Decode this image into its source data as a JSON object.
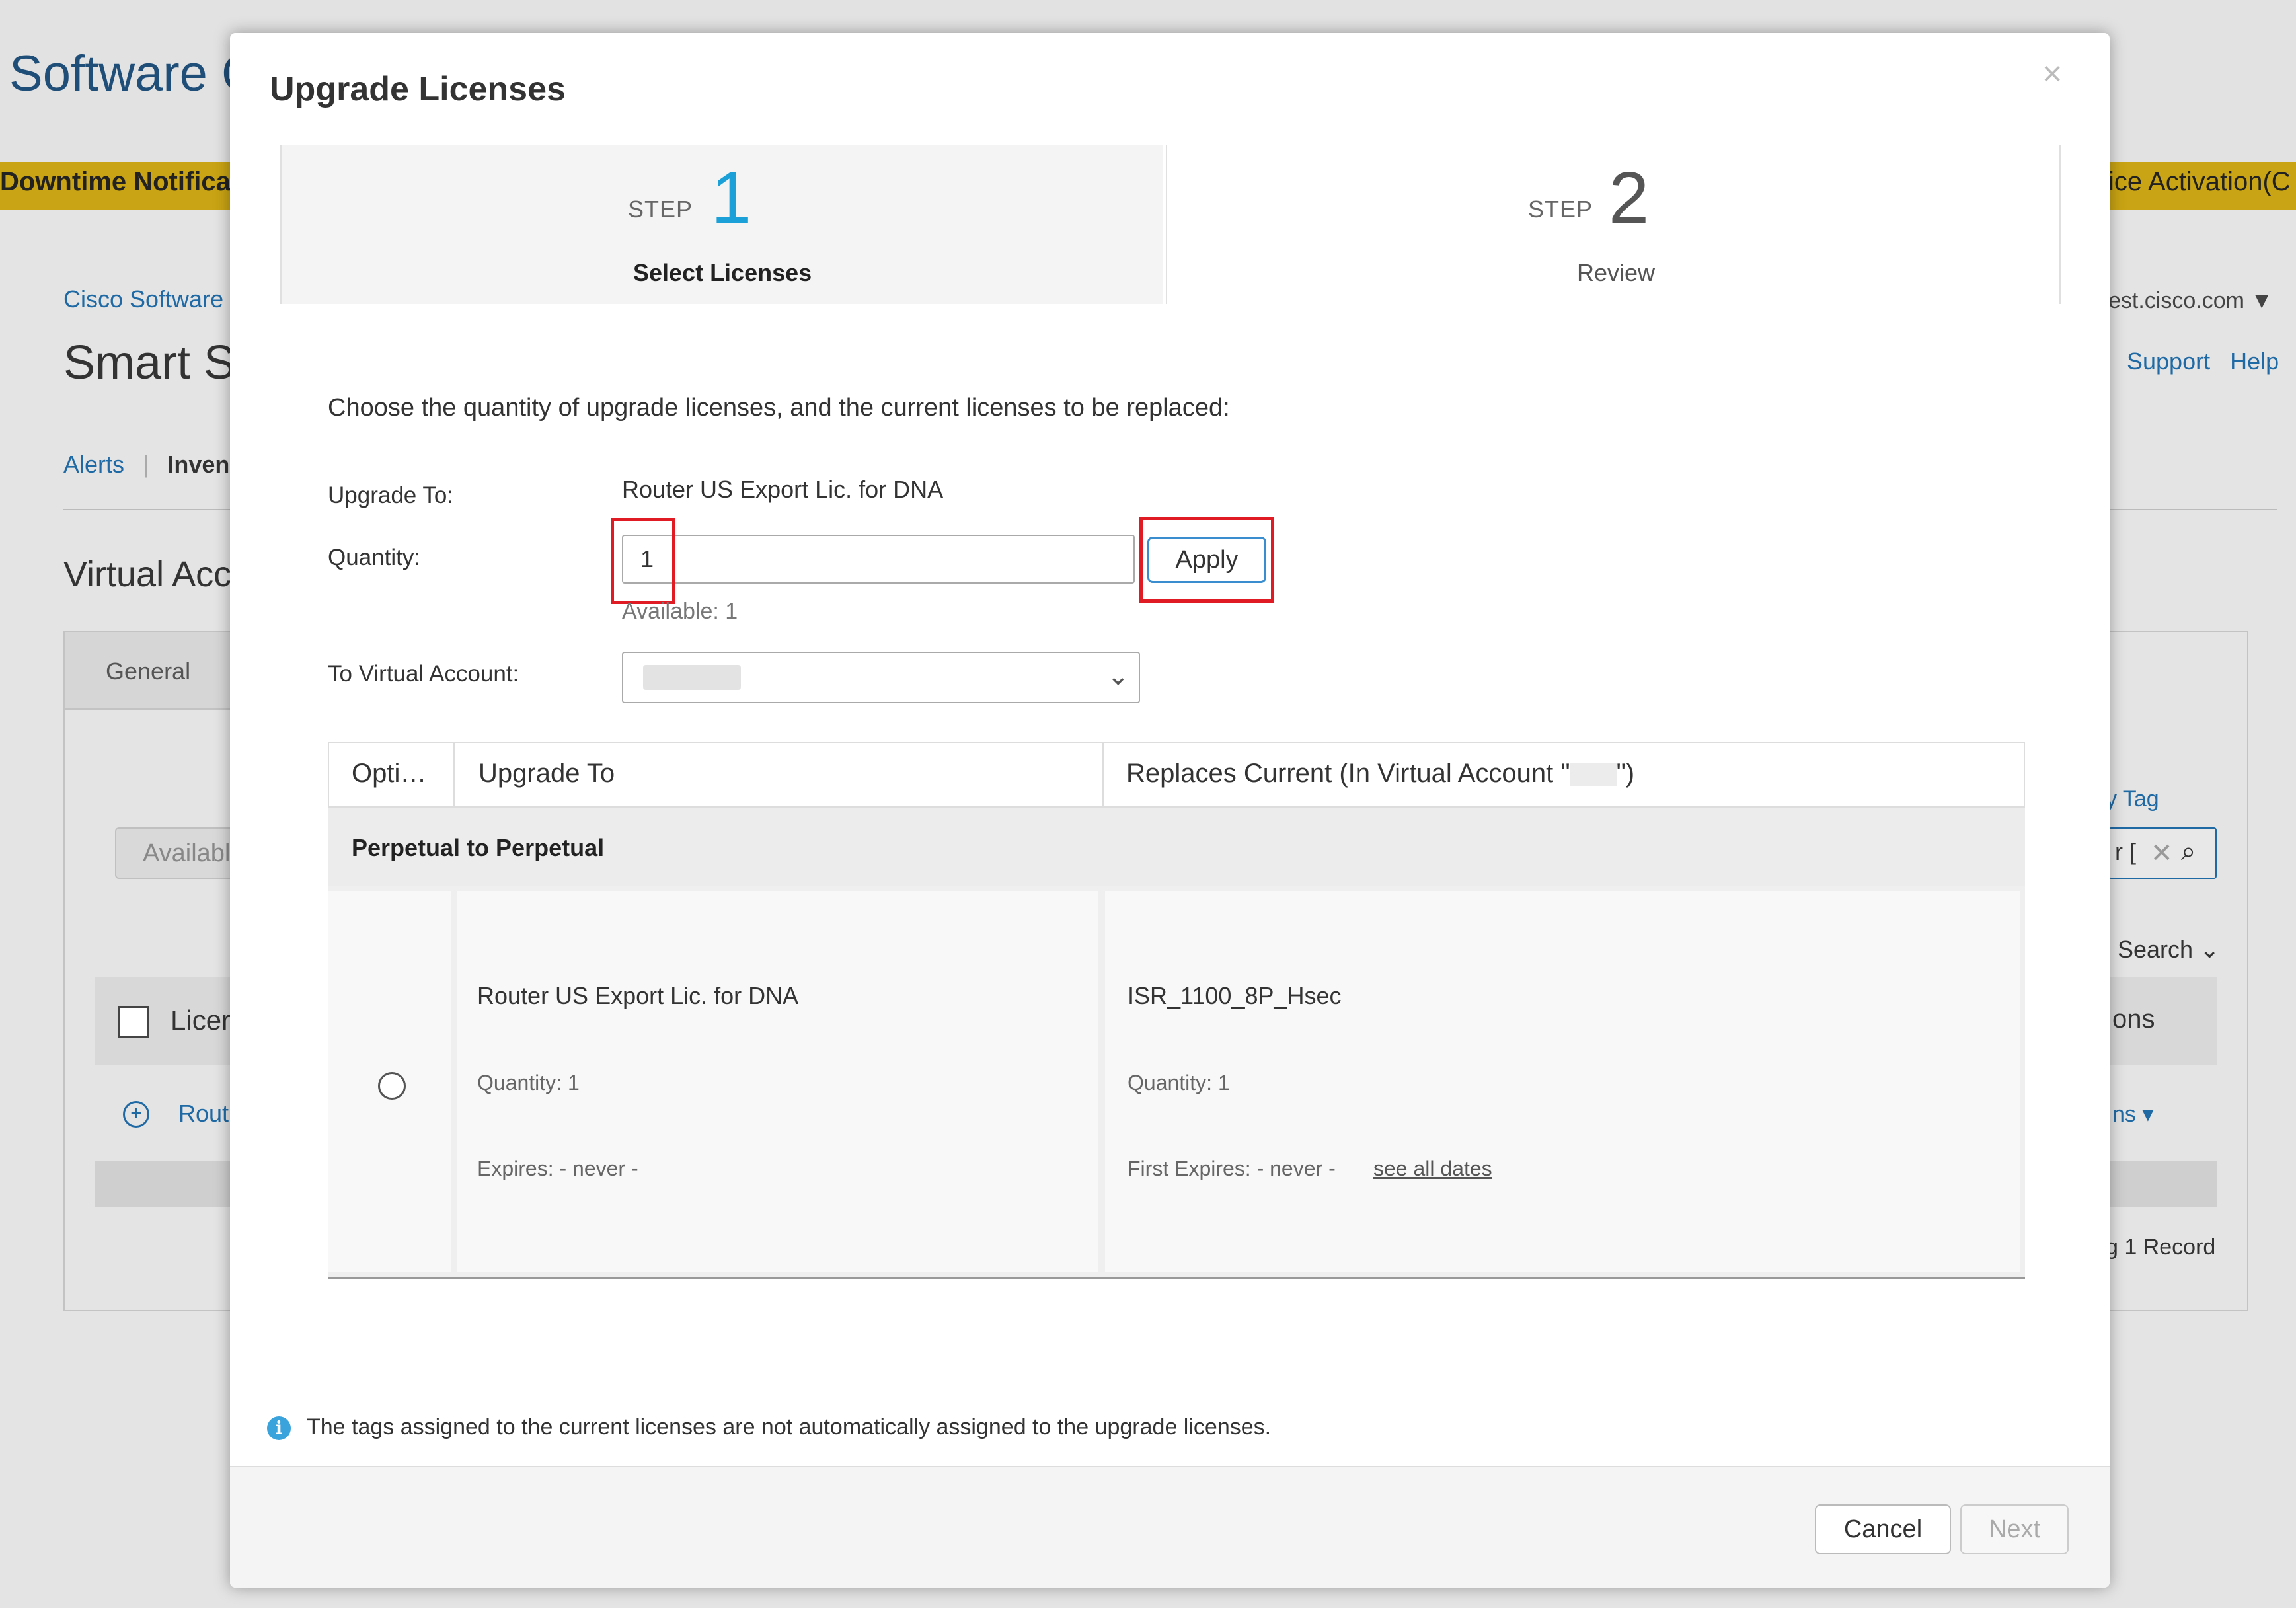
{
  "background": {
    "app_title": "Software C",
    "banner_left": "Downtime Notifica",
    "banner_right": "ice Activation(C",
    "breadcrumb": "Cisco Software C",
    "page_title": "Smart S",
    "nav_alerts": "Alerts",
    "nav_inventory": "Inven",
    "section_title": "Virtual Acc",
    "tab_general": "General",
    "available_button": "Availabl",
    "license_header": "Licer",
    "row_link": "Rout",
    "user_email": "est.cisco.com",
    "support_link": "Support",
    "help_link": "Help",
    "tag_label": "y Tag",
    "search_text": "r [",
    "advanced_search": "l Search",
    "actions_header": "ons",
    "actions_link": "ns",
    "record_count": "g 1 Record"
  },
  "modal": {
    "title": "Upgrade Licenses",
    "close_symbol": "×",
    "steps": [
      {
        "word": "STEP",
        "number": "1",
        "label": "Select Licenses",
        "active": true
      },
      {
        "word": "STEP",
        "number": "2",
        "label": "Review",
        "active": false
      }
    ],
    "instruction": "Choose the quantity of upgrade licenses, and the current licenses to be replaced:",
    "upgrade_to_label": "Upgrade To:",
    "upgrade_to_value": "Router US Export Lic. for DNA",
    "quantity_label": "Quantity:",
    "quantity_value": "1",
    "apply_label": "Apply",
    "available_text": "Available: 1",
    "virtual_account_label": "To Virtual Account:",
    "table": {
      "columns": [
        "Opti…",
        "Upgrade To",
        "Replaces Current (In Virtual Account \"",
        "\")"
      ],
      "group": "Perpetual to Perpetual",
      "rows": [
        {
          "upgrade_name": "Router US Export Lic. for DNA",
          "upgrade_quantity": "Quantity: 1",
          "upgrade_expires": "Expires: - never -",
          "current_name": "ISR_1100_8P_Hsec",
          "current_quantity": "Quantity: 1",
          "current_expires": "First Expires: - never -",
          "see_all_dates": "see all dates"
        }
      ]
    },
    "info_icon": "i",
    "info_note": "The tags assigned to the current licenses are not automatically assigned to the upgrade licenses.",
    "cancel_label": "Cancel",
    "next_label": "Next"
  },
  "colors": {
    "accent": "#1ba0d7",
    "highlight": "#e01b24",
    "banner": "#c9a414",
    "link": "#1f6aa5"
  }
}
